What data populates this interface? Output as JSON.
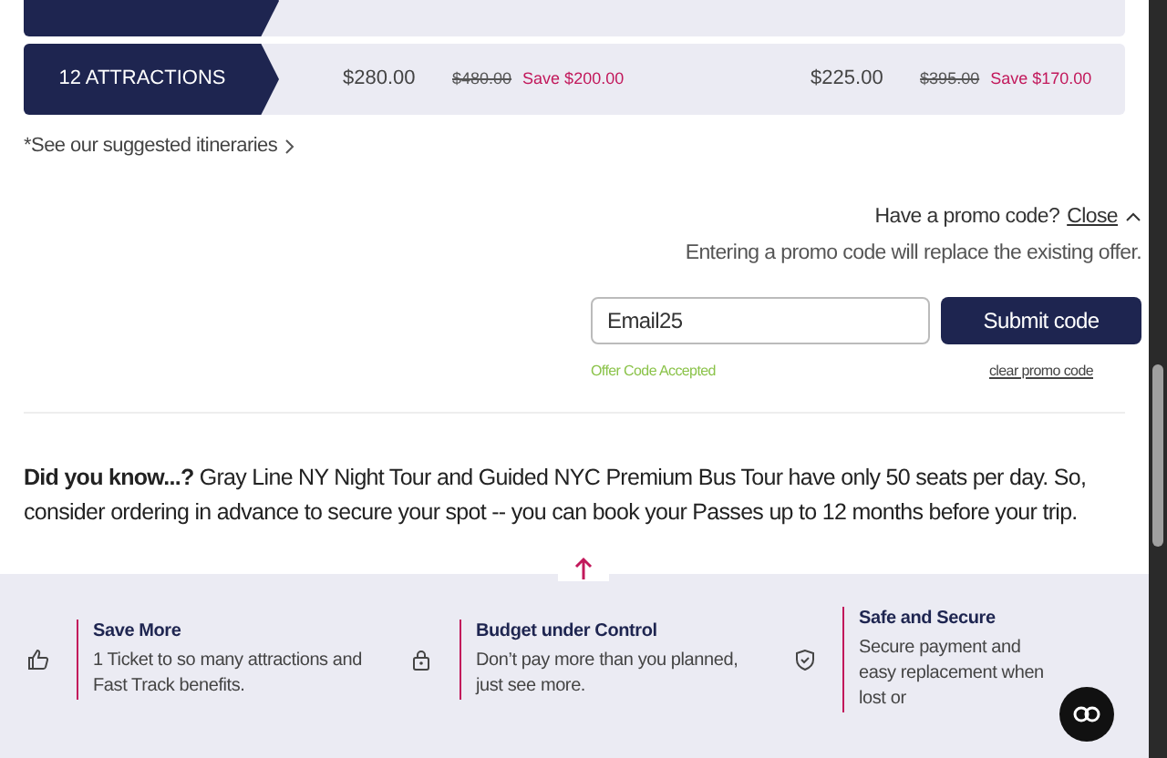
{
  "pricing_rows": [
    {
      "label": "12 ATTRACTIONS",
      "price_1": "$280.00",
      "was_1": "$480.00",
      "save_1": "Save $200.00",
      "price_2": "$225.00",
      "was_2": "$395.00",
      "save_2": "Save $170.00"
    }
  ],
  "itineraries_link": "*See our suggested itineraries",
  "promo": {
    "question": "Have a promo code?",
    "toggle": "Close",
    "expanded": true,
    "note": "Entering a promo code will replace the existing offer.",
    "value": "Email25",
    "submit": "Submit code",
    "status": "Offer Code Accepted",
    "clear": "clear promo code"
  },
  "did_you_know": "**Did you know...?** Gray Line NY Night Tour and Guided NYC Premium Bus Tour have only 50 seats per day. So, consider ordering in advance to secure your spot -- you can book your Passes up to 12 months before your trip.",
  "benefits": [
    {
      "kind": "thumb",
      "title": "Save More",
      "text": "1 Ticket to so many attractions and Fast Track benefits."
    },
    {
      "kind": "lock",
      "title": "Budget under Control",
      "text": "Don’t pay more than you planned, just see more."
    },
    {
      "kind": "shield",
      "title": "Safe and Secure",
      "text": "Secure payment and easy replacement when lost or"
    }
  ]
}
